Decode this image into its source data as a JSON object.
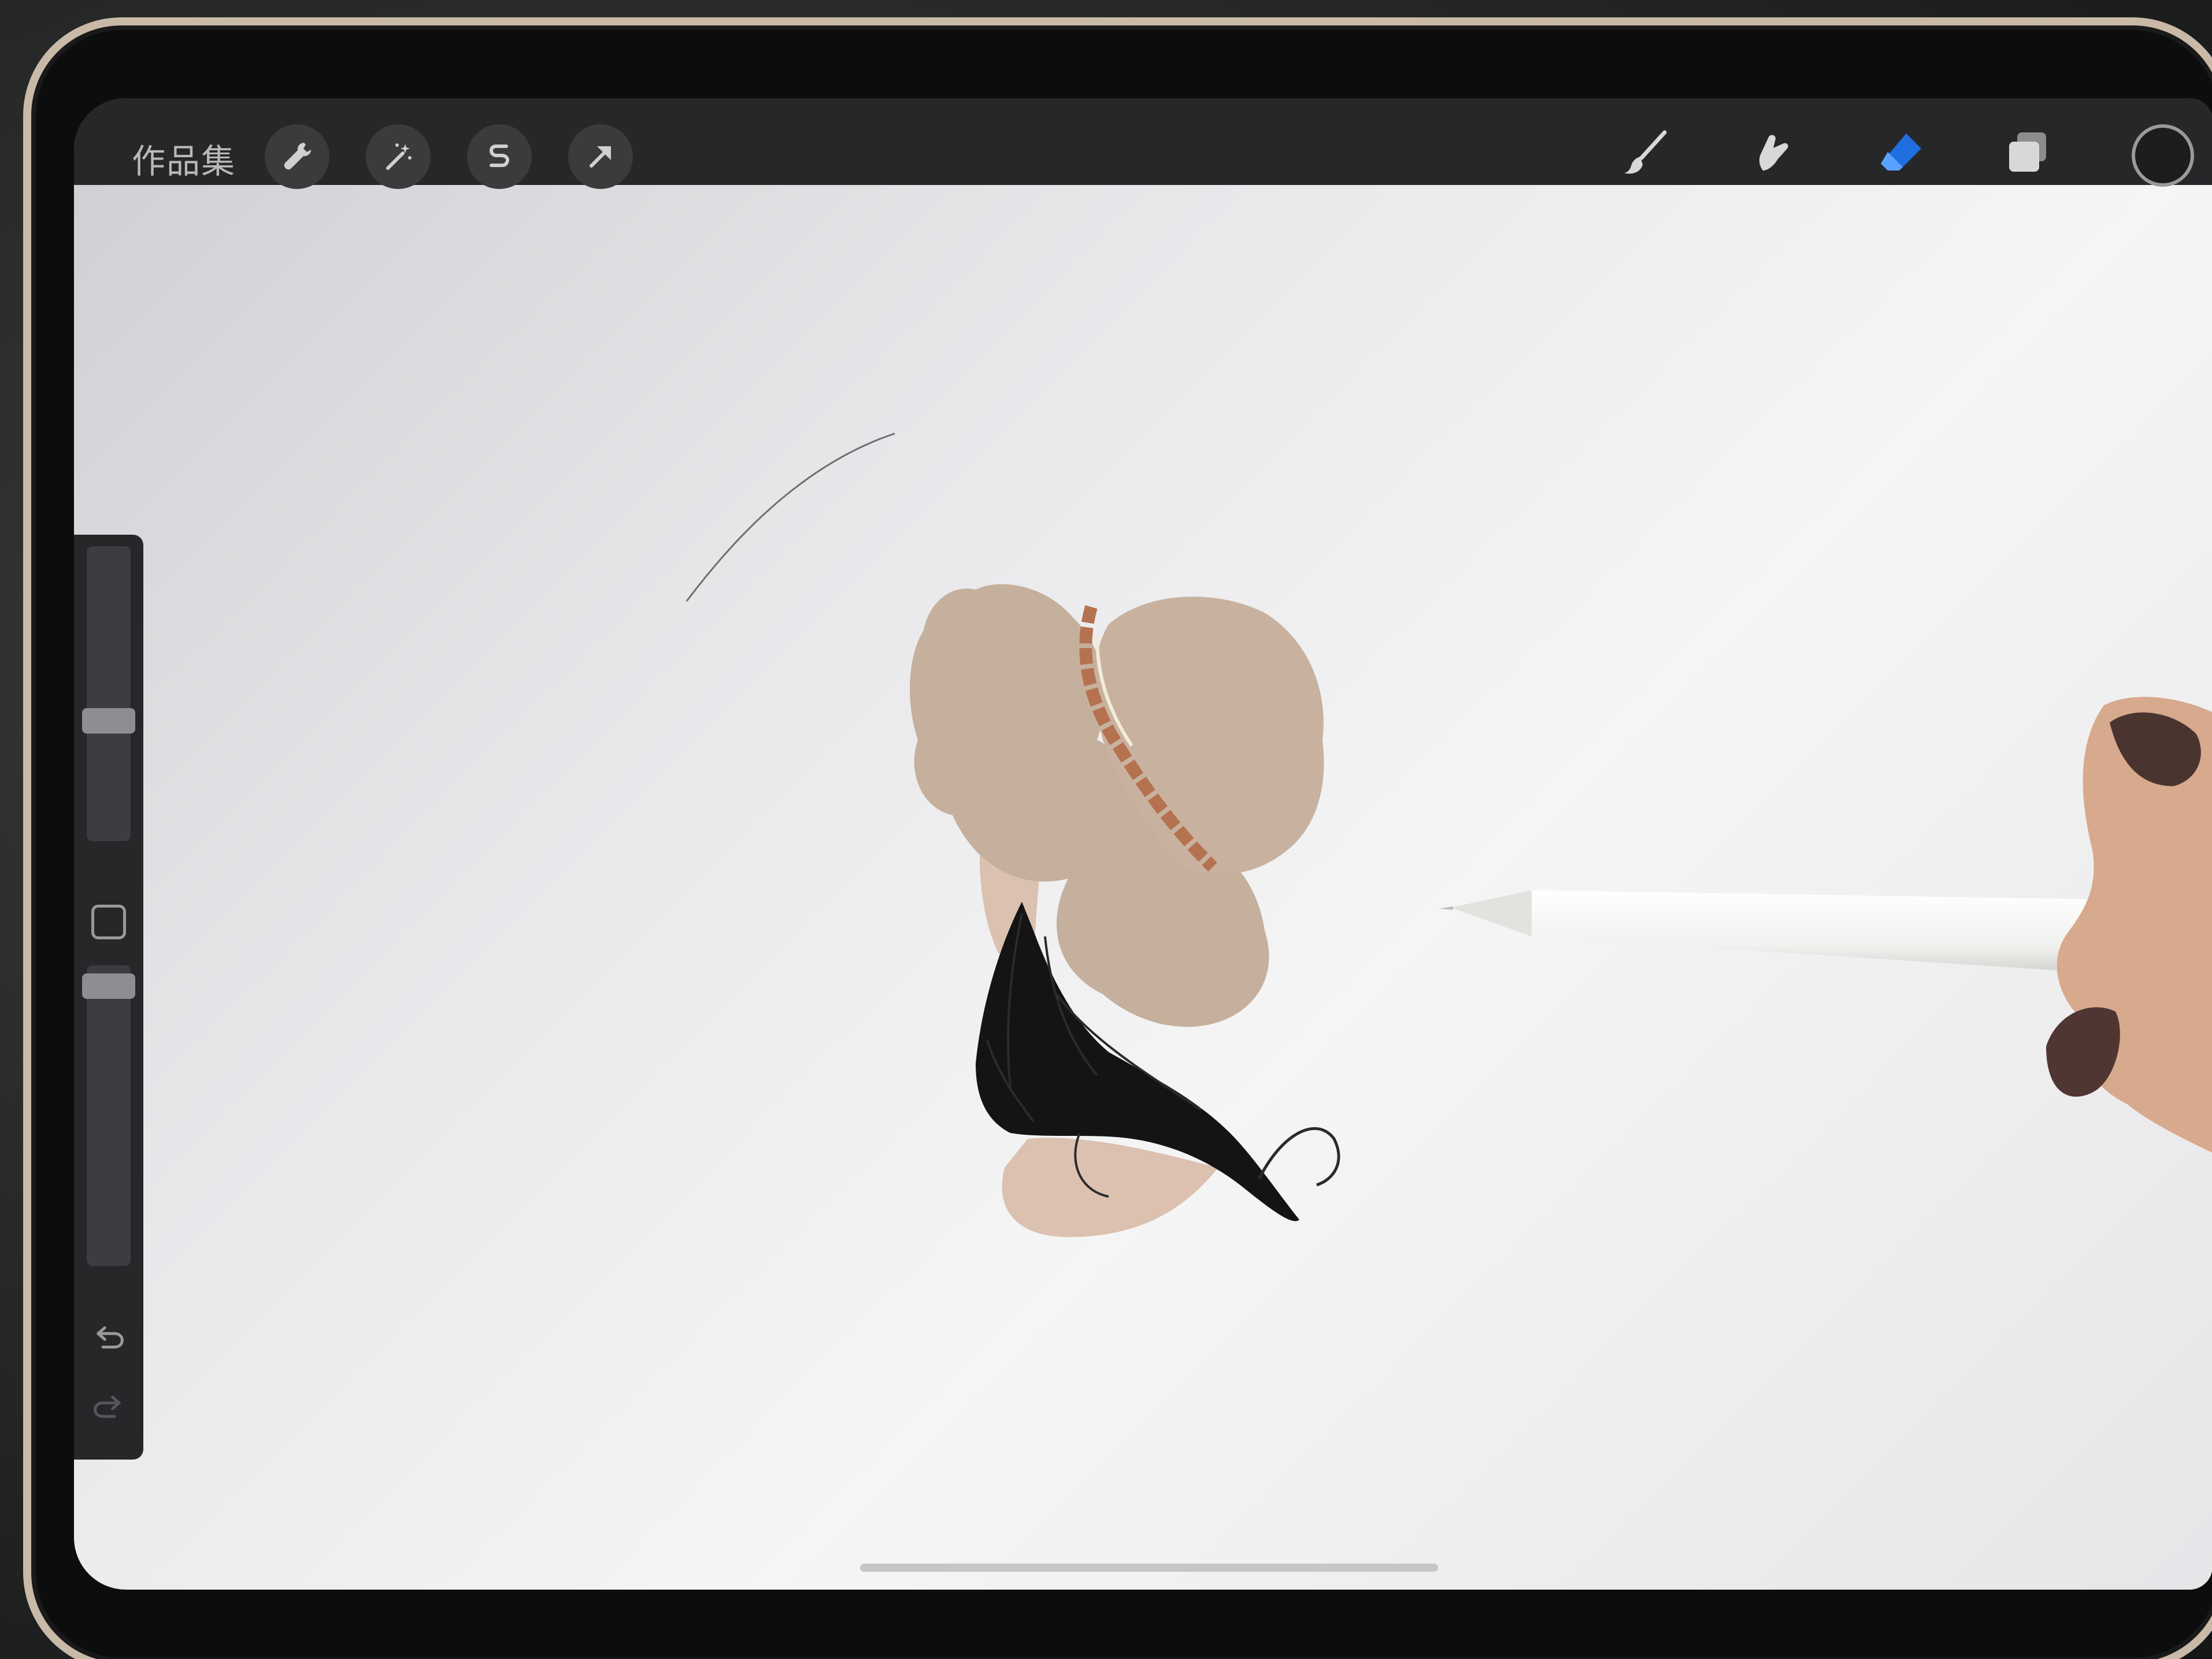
{
  "topbar": {
    "gallery_label": "作品集",
    "tools_left": [
      {
        "name": "actions",
        "icon": "wrench-icon"
      },
      {
        "name": "adjustments",
        "icon": "magic-wand-icon"
      },
      {
        "name": "selection",
        "icon": "selection-s-icon"
      },
      {
        "name": "transform",
        "icon": "arrow-cursor-icon"
      }
    ],
    "tools_right": [
      {
        "name": "brush",
        "icon": "brush-icon",
        "active": false
      },
      {
        "name": "smudge",
        "icon": "smudge-finger-icon",
        "active": false
      },
      {
        "name": "eraser",
        "icon": "eraser-icon",
        "active": true
      },
      {
        "name": "layers",
        "icon": "layers-icon",
        "active": false
      }
    ],
    "active_color": "#1d1d1d",
    "accent_color": "#1f6fe0"
  },
  "sidebar": {
    "brush_size_level": 0.4,
    "brush_opacity_level": 0.97,
    "icons": [
      "modify-square-icon",
      "undo-icon",
      "redo-icon"
    ]
  }
}
